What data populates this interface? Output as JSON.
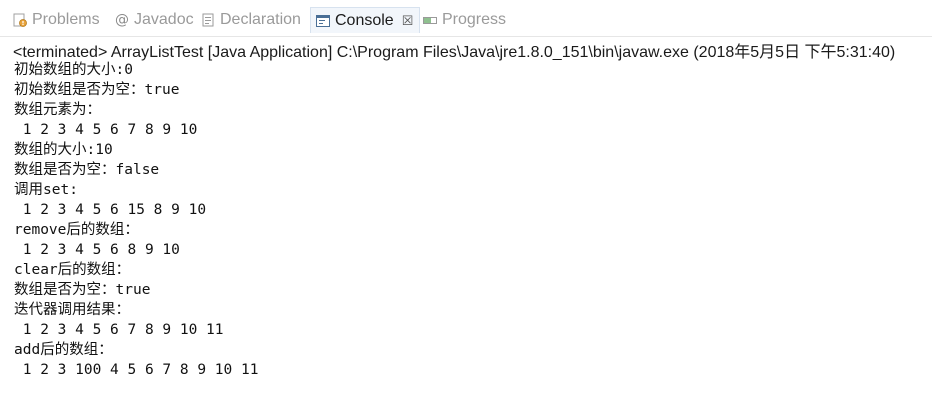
{
  "tabs": [
    {
      "label": "Problems",
      "icon": "problems-icon"
    },
    {
      "label": "Javadoc",
      "icon": "javadoc-icon"
    },
    {
      "label": "Declaration",
      "icon": "declaration-icon"
    },
    {
      "label": "Console",
      "icon": "console-icon",
      "active": true,
      "close": "☒"
    },
    {
      "label": "Progress",
      "icon": "progress-icon"
    }
  ],
  "status": "<terminated> ArrayListTest [Java Application] C:\\Program Files\\Java\\jre1.8.0_151\\bin\\javaw.exe (2018年5月5日 下午5:31:40)",
  "console_lines": [
    "初始数组的大小:0",
    "初始数组是否为空：true",
    "数组元素为：",
    " 1 2 3 4 5 6 7 8 9 10",
    "数组的大小:10",
    "数组是否为空：false",
    "调用set:",
    " 1 2 3 4 5 6 15 8 9 10",
    "remove后的数组：",
    " 1 2 3 4 5 6 8 9 10",
    "clear后的数组：",
    "数组是否为空：true",
    "迭代器调用结果：",
    " 1 2 3 4 5 6 7 8 9 10 11",
    "add后的数组：",
    " 1 2 3 100 4 5 6 7 8 9 10 11"
  ]
}
